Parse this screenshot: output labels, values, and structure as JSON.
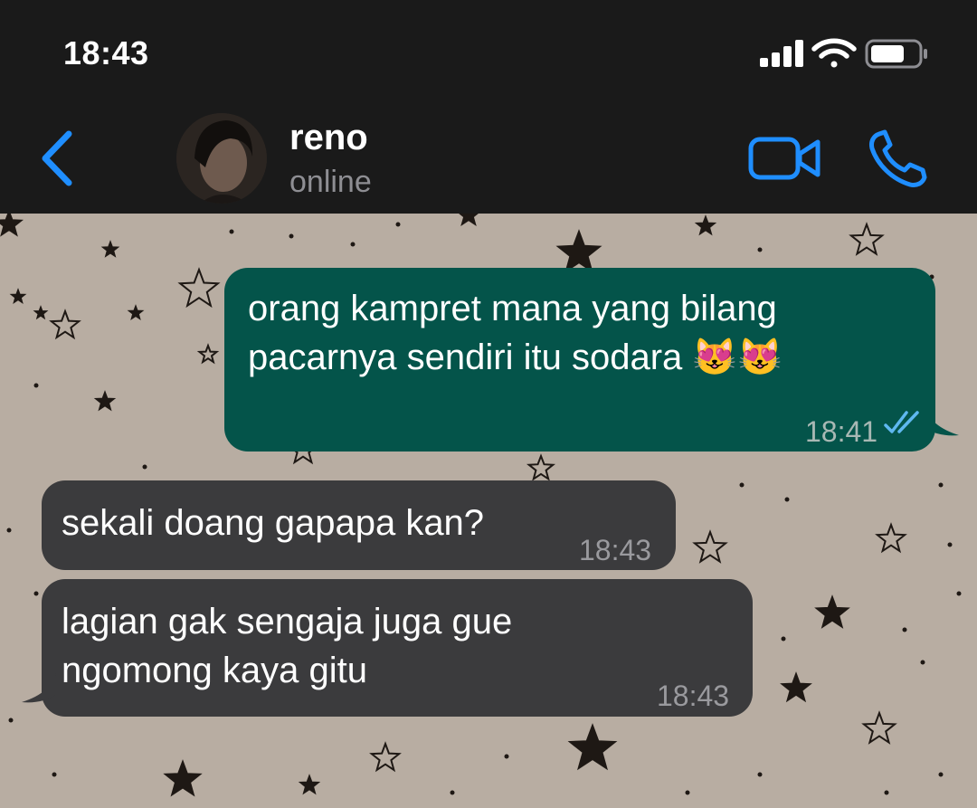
{
  "status_bar": {
    "time": "18:43",
    "icons": [
      "signal-icon",
      "wifi-icon",
      "battery-icon"
    ]
  },
  "header": {
    "back_icon": "chevron-left-icon",
    "contact_name": "reno",
    "contact_status": "online",
    "video_icon": "video-camera-icon",
    "call_icon": "phone-icon",
    "accent_color": "#1f8eff"
  },
  "messages": [
    {
      "direction": "outgoing",
      "text": "orang kampret mana yang bilang\npacarnya sendiri itu sodara 😻😻",
      "time": "18:41",
      "read_status": "double-check-icon"
    },
    {
      "direction": "incoming",
      "text": "sekali doang gapapa kan?",
      "time": "18:43"
    },
    {
      "direction": "incoming",
      "text": "lagian gak sengaja juga gue\nngomong kaya gitu",
      "time": "18:43"
    }
  ],
  "colors": {
    "header_bg": "#1a1a1a",
    "outgoing_bubble": "#04544a",
    "incoming_bubble": "#3b3b3d",
    "wallpaper": "#b8ada2",
    "read_check": "#5fb8f0"
  }
}
